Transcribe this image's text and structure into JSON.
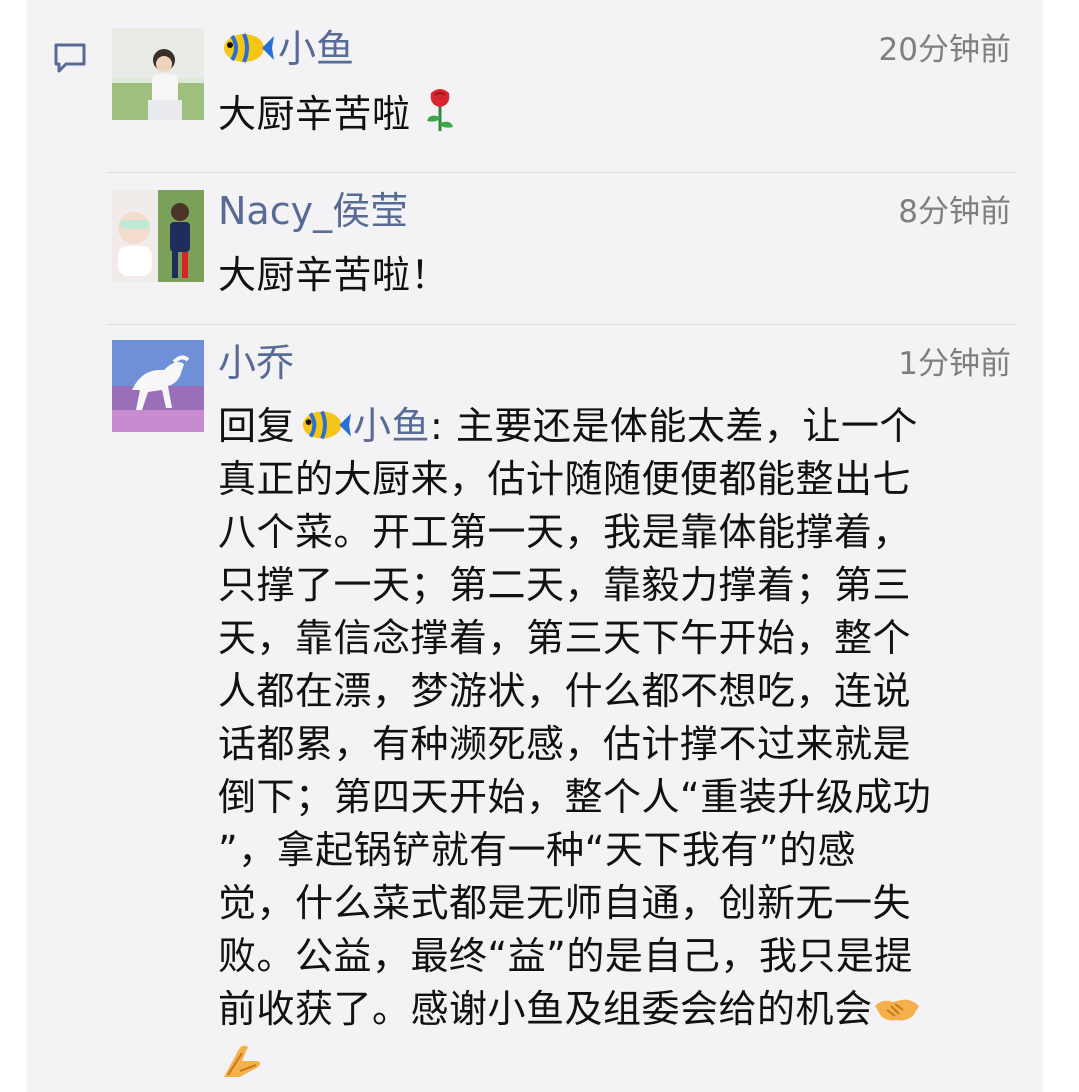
{
  "comments": [
    {
      "author": "小鱼",
      "author_icon": "tropical-fish-icon",
      "time": "20分钟前",
      "text": "大厨辛苦啦",
      "trailing_icon": "rose-icon"
    },
    {
      "author": "Nacy_侯莹",
      "time": "8分钟前",
      "text": "大厨辛苦啦！"
    },
    {
      "author": "小乔",
      "time": "1分钟前",
      "reply_prefix": "回复",
      "reply_to": "小鱼",
      "reply_to_icon": "tropical-fish-icon",
      "reply_colon": ":",
      "lines": [
        " 主要还是体能太差，让一个",
        "真正的大厨来，估计随随便便都能整出七",
        "八个菜。开工第一天，我是靠体能撑着，",
        "只撑了一天；第二天，靠毅力撑着；第三",
        "天，靠信念撑着，第三天下午开始，整个",
        "人都在漂，梦游状，什么都不想吃，连说",
        "话都累，有种濒死感，估计撑不过来就是",
        "倒下；第四天开始，整个人“重装升级成功",
        "”，拿起锅铲就有一种“天下我有”的感",
        "觉，什么菜式都是无师自通，创新无一失",
        "败。公益，最终“益”的是自己，我只是提",
        "前收获了。感谢小鱼及组委会给的机会"
      ],
      "trailing_icons": [
        "handshake-icon",
        "pray-hands-icon"
      ]
    }
  ],
  "colors": {
    "name": "#576b95",
    "text": "#111111",
    "time": "#7f7f7f",
    "panel_bg": "#f3f3f5",
    "divider": "#dcdcdc"
  }
}
